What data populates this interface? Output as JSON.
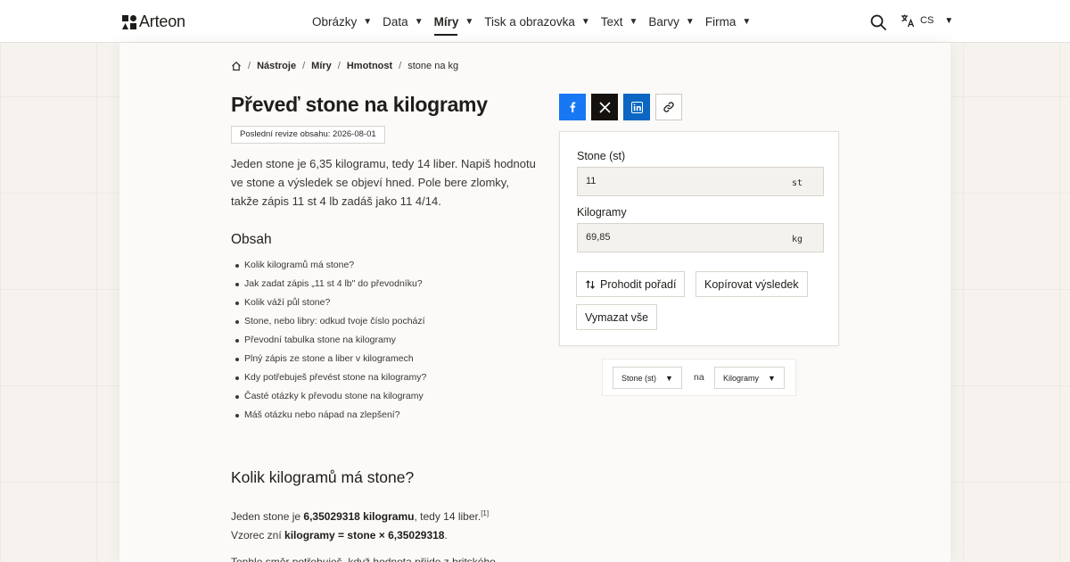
{
  "header": {
    "logo_text": "Arteon",
    "nav": [
      {
        "label": "Obrázky",
        "active": false
      },
      {
        "label": "Data",
        "active": false
      },
      {
        "label": "Míry",
        "active": true
      },
      {
        "label": "Tisk a obrazovka",
        "active": false
      },
      {
        "label": "Text",
        "active": false
      },
      {
        "label": "Barvy",
        "active": false
      },
      {
        "label": "Firma",
        "active": false
      }
    ],
    "search_icon": "search-icon",
    "language": "CS"
  },
  "breadcrumb": {
    "home_icon": "home-icon",
    "items": [
      "Nástroje",
      "Míry",
      "Hmotnost"
    ],
    "current": "stone na kg"
  },
  "page": {
    "title": "Převeď stone na kilogramy",
    "revision": "Poslední revize obsahu: 2026-08-01",
    "intro": "Jeden stone je 6,35 kilogramu, tedy 14 liber. Napiš hodnotu ve stone a výsledek se objeví hned. Pole bere zlomky, takže zápis 11 st 4 lb zadáš jako 11 4/14."
  },
  "toc": {
    "heading": "Obsah",
    "items": [
      "Kolik kilogramů má stone?",
      "Jak zadat zápis „11 st 4 lb\" do převodníku?",
      "Kolik váží půl stone?",
      "Stone, nebo libry: odkud tvoje číslo pochází",
      "Převodní tabulka stone na kilogramy",
      "Plný zápis ze stone a liber v kilogramech",
      "Kdy potřebuješ převést stone na kilogramy?",
      "Časté otázky k převodu stone na kilogramy",
      "Máš otázku nebo nápad na zlepšení?"
    ]
  },
  "section": {
    "heading": "Kolik kilogramů má stone?",
    "p1_a": "Jeden stone je ",
    "p1_b": "6,35029318 kilogramu",
    "p1_c": ", tedy 14 liber.",
    "p1_ref": "[1]",
    "p2_a": "Vzorec zní ",
    "p2_b": "kilogramy = stone × 6,35029318",
    "p2_c": ".",
    "p3": "Tenhle směr potřebuješ, když hodnota přijde z britského"
  },
  "share": {
    "facebook_icon": "facebook-icon",
    "x_icon": "x-icon",
    "linkedin_icon": "linkedin-icon",
    "link_icon": "link-icon"
  },
  "converter": {
    "from_label": "Stone (st)",
    "from_value": "11",
    "from_unit": "st",
    "to_label": "Kilogramy",
    "to_value": "69,85",
    "to_unit": "kg",
    "swap_label": "Prohodit pořadí",
    "swap_icon": "swap-arrows-icon",
    "copy_label": "Kopírovat výsledek",
    "clear_label": "Vymazat vše"
  },
  "unit_selector": {
    "from": "Stone (st)",
    "separator": "na",
    "to": "Kilogramy"
  },
  "colors": {
    "facebook": "#1877f2",
    "x": "#14110f",
    "linkedin": "#0a66c2",
    "background": "#f6f3ee"
  }
}
